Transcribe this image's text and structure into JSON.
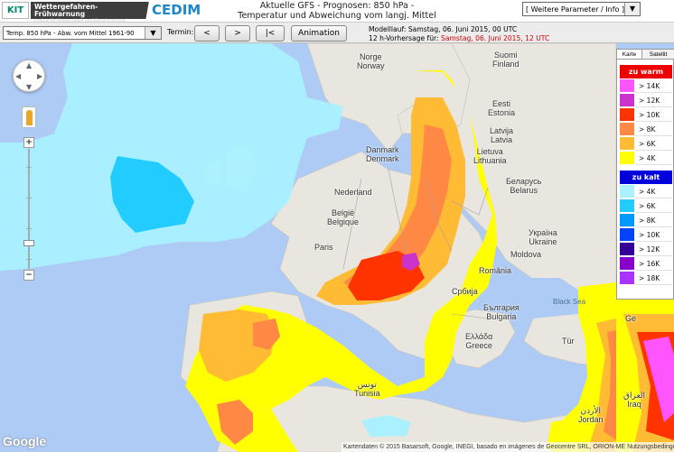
{
  "header": {
    "logo_kit": "KIT",
    "logo_wfw_title": "Wettergefahren-Frühwarnung",
    "logo_wfw_sub": "Institut für Meteorologie und Klimaforschung",
    "logo_cedim": "CEDIM",
    "title_line1": "Aktuelle GFS - Prognosen: 850 hPa -",
    "title_line2": "Temperatur und Abweichung vom langj. Mittel",
    "param_select_value": "[ Weitere Parameter / Info ]"
  },
  "toolbar": {
    "product_select_value": "Temp. 850 hPa - Abw. vom Mittel 1961-90",
    "termin_label": "Termin:",
    "btn_prev": "<",
    "btn_next": ">",
    "btn_first": "|<",
    "btn_animation": "Animation",
    "model_run_label": "Modelllauf: Samstag, 06. Juni 2015, 00 UTC",
    "forecast_label": "12 h-Vorhersage für:",
    "forecast_value": "Samstag, 06. Juni 2015, 12 UTC"
  },
  "map": {
    "labels": {
      "norge": "Norge",
      "norway": "Norway",
      "suomi": "Suomi",
      "finland": "Finland",
      "eesti": "Eesti",
      "estonia": "Estonia",
      "latvija": "Latvija",
      "latvia": "Latvia",
      "lietuva": "Lietuva",
      "lithuania": "Lithuania",
      "danmark": "Danmark",
      "denmark": "Denmark",
      "belarus_native": "Беларусь",
      "belarus": "Belarus",
      "nederland": "Nederland",
      "belgie": "België",
      "belgique": "Belgique",
      "ukraina": "Україна",
      "ukraine": "Ukraine",
      "paris": "Paris",
      "moldova": "Moldova",
      "romania": "România",
      "srbija": "Србија",
      "bulgaria_native": "България",
      "bulgaria": "Bulgaria",
      "greece_native": "Ελλάδα",
      "greece": "Greece",
      "black_sea": "Black Sea",
      "tunisia_native": "تونس",
      "tunisia": "Tunisia",
      "turkey": "Tür",
      "iraq_native": "العراق",
      "iraq": "Iraq",
      "jordan_native": "الأردن",
      "jordan": "Jordan",
      "georgia": "Ge"
    },
    "google_logo": "Google",
    "copyright": "Kartendaten © 2015 Basarsoft, Google, INEGI, basado en imágenes de Geocentre SRL, ORION-ME   Nutzungsbedingungen"
  },
  "legend": {
    "tab_map": "Karte",
    "tab_sat": "Satellit",
    "warm_header": "zu warm",
    "cold_header": "zu kalt",
    "warm": [
      {
        "label": "> 14K",
        "color": "#ff55ff"
      },
      {
        "label": "> 12K",
        "color": "#cc33cc"
      },
      {
        "label": "> 10K",
        "color": "#ff3300"
      },
      {
        "label": "> 8K",
        "color": "#ff8844"
      },
      {
        "label": "> 6K",
        "color": "#ffbb33"
      },
      {
        "label": "> 4K",
        "color": "#ffff00"
      }
    ],
    "cold": [
      {
        "label": "> 4K",
        "color": "#aaf0ff"
      },
      {
        "label": "> 6K",
        "color": "#22ccff"
      },
      {
        "label": "> 8K",
        "color": "#0099ff"
      },
      {
        "label": "> 10K",
        "color": "#0044ff"
      },
      {
        "label": "> 12K",
        "color": "#330099"
      },
      {
        "label": "> 16K",
        "color": "#8800cc"
      },
      {
        "label": "> 18K",
        "color": "#aa33ff"
      }
    ]
  }
}
